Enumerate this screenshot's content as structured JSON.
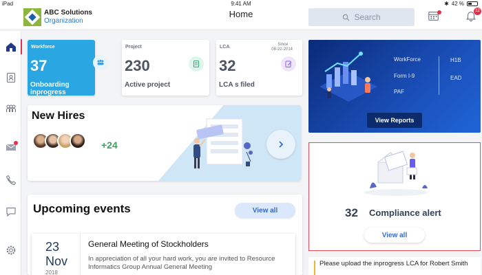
{
  "status_bar": {
    "device": "iPad",
    "time": "9:41 AM",
    "battery": "42 %"
  },
  "header": {
    "brand_name": "ABC Solutions",
    "brand_sub": "Organization",
    "title": "Home",
    "search_placeholder": "Search",
    "notification_count": "12"
  },
  "sidebar": {
    "items": [
      {
        "name": "home",
        "active": true
      },
      {
        "name": "contacts"
      },
      {
        "name": "team"
      },
      {
        "name": "messages"
      },
      {
        "name": "calls"
      },
      {
        "name": "chat"
      },
      {
        "name": "settings"
      }
    ]
  },
  "stats": [
    {
      "label": "Workforce",
      "value": "37",
      "desc": "Onboarding inprogress"
    },
    {
      "label": "Project",
      "value": "230",
      "desc": "Active project"
    },
    {
      "label": "LCA",
      "value": "32",
      "desc": "LCA s filed",
      "since_label": "Since",
      "since_date": "08-22-2014"
    }
  ],
  "new_hires": {
    "title": "New Hires",
    "count": "+24"
  },
  "events": {
    "title": "Upcoming events",
    "view_all": "View all",
    "item": {
      "day": "23",
      "month": "Nov",
      "year": "2018",
      "name": "General Meeting of Stockholders",
      "text": "In appreciation of all your hard work, you are invited to Resource Informatics Group Annual General Meeting"
    }
  },
  "reports": {
    "links_left": [
      "WorkForce",
      "Form I-9",
      "PAF"
    ],
    "links_right": [
      "H1B",
      "EAD"
    ],
    "button": "View Reports"
  },
  "compliance": {
    "count": "32",
    "label": "Compliance alert",
    "view_all": "View all"
  },
  "task": {
    "text": "Please upload the inprogress LCA for Robert Smith"
  },
  "colors": {
    "accent": "#2aa6e3",
    "brand_green": "#8db63c",
    "alert_red": "#e24b57",
    "report_blue": "#1a4fb8"
  }
}
